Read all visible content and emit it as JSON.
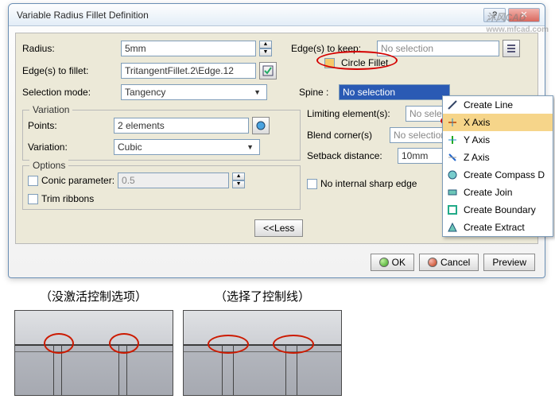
{
  "dialog": {
    "title": "Variable Radius Fillet Definition",
    "radius_label": "Radius:",
    "radius_value": "5mm",
    "edges_keep_label": "Edge(s) to keep:",
    "edges_keep_value": "No selection",
    "edges_fillet_label": "Edge(s) to fillet:",
    "edges_fillet_value": "TritangentFillet.2\\Edge.12",
    "circle_fillet_label": "Circle Fillet",
    "selmode_label": "Selection mode:",
    "selmode_value": "Tangency",
    "spine_label": "Spine :",
    "spine_value": "No selection",
    "variation_group": "Variation",
    "points_label": "Points:",
    "points_value": "2 elements",
    "variation_label": "Variation:",
    "variation_value": "Cubic",
    "limiting_label": "Limiting element(s):",
    "limiting_value": "No selection",
    "blend_label": "Blend corner(s)",
    "blend_value": "No selection",
    "setback_label": "Setback distance:",
    "setback_value": "10mm",
    "options_group": "Options",
    "conic_label": "Conic parameter:",
    "conic_value": "0.5",
    "trim_label": "Trim ribbons",
    "nosharp_label": "No internal sharp edge",
    "less_label": "<<Less",
    "ok": "OK",
    "cancel": "Cancel",
    "preview": "Preview"
  },
  "context_menu": {
    "items": [
      "Create Line",
      "X Axis",
      "Y Axis",
      "Z Axis",
      "Create Compass D",
      "Create Join",
      "Create Boundary",
      "Create Extract"
    ]
  },
  "captions": {
    "left": "（没激活控制选项）",
    "right": "（选择了控制线）"
  },
  "watermark": {
    "brand": "沐风CAD",
    "url": "www.mfcad.com"
  }
}
